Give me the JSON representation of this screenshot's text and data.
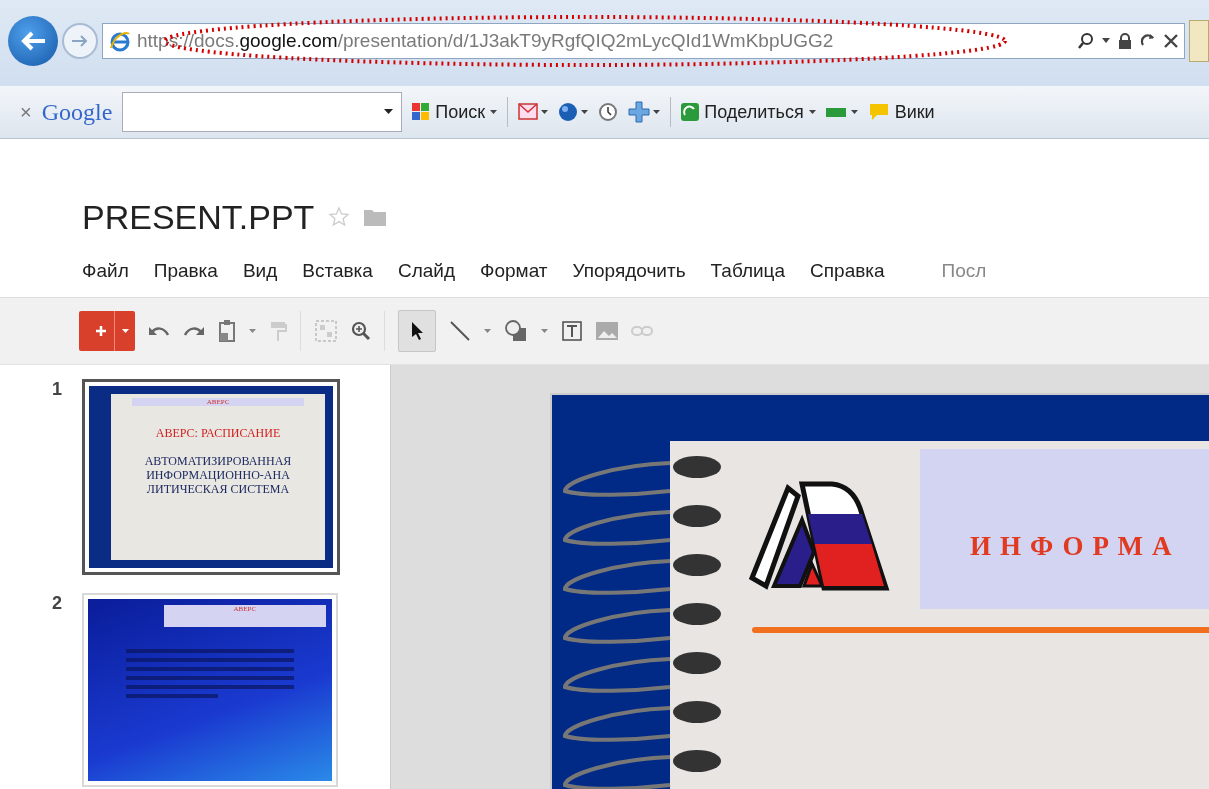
{
  "browser": {
    "url": "https://docs.**google.com**/presentation/d/1J3akT9yRgfQIQ2mLycQId1WmKbpUGG2",
    "close_toolbar": "×",
    "search_engine": "Google",
    "search_button": "Поиск",
    "share_button": "Поделиться",
    "wiki_button": "Вики"
  },
  "document": {
    "title": "PRESENT.PPT",
    "starred": false
  },
  "menu": [
    "Файл",
    "Правка",
    "Вид",
    "Вставка",
    "Слайд",
    "Формат",
    "Упорядочить",
    "Таблица",
    "Справка"
  ],
  "menu_note": "Посл",
  "toolbar": {
    "pointer_selected": true
  },
  "slides": [
    {
      "number": "1",
      "selected": true,
      "kind": "title",
      "header": "АВЕРС",
      "heading": "АВЕРС: РАСПИСАНИЕ",
      "title": "АВТОМАТИЗИРОВАННАЯ ИНФОРМАЦИОННО-АНА ЛИТИЧЕСКАЯ СИСТЕМА"
    },
    {
      "number": "2",
      "selected": false,
      "kind": "text",
      "header": "АВЕРС"
    }
  ],
  "current_slide": {
    "header_text": "ИНФОРМА"
  }
}
